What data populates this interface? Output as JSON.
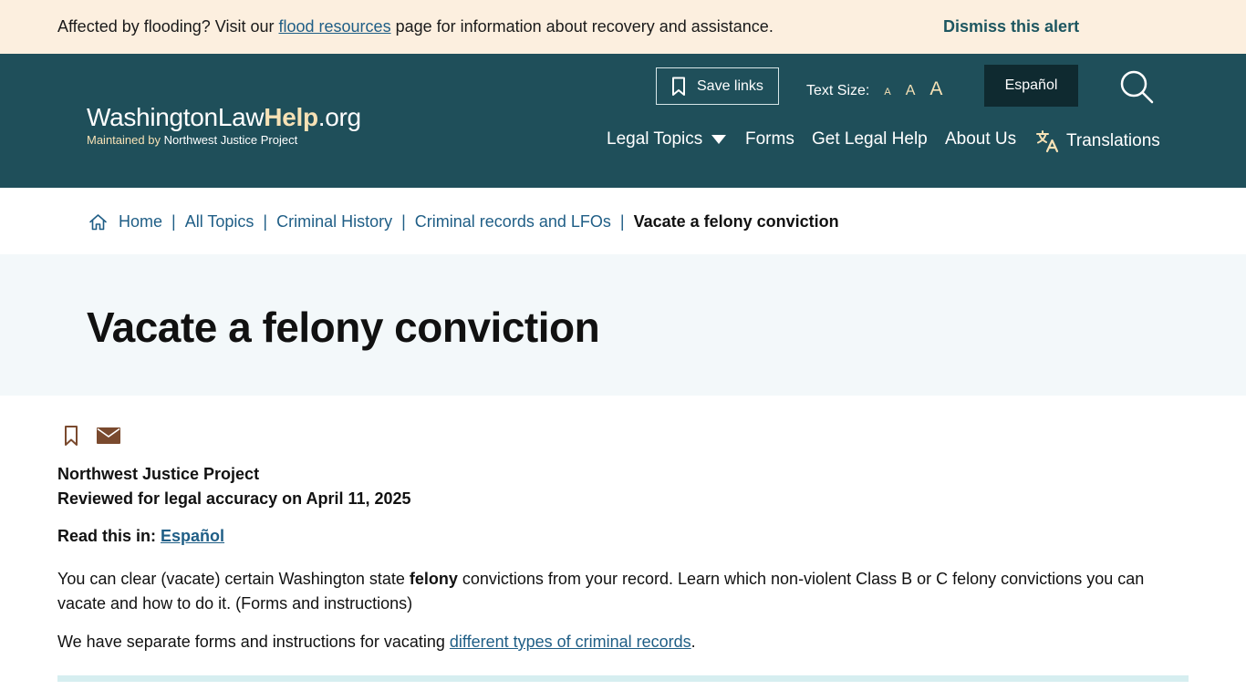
{
  "alert": {
    "prefix": "Affected by flooding? Visit our ",
    "link": "flood resources",
    "suffix": " page for information about recovery and assistance.",
    "dismiss": "Dismiss this alert"
  },
  "header": {
    "logo_main": "WashingtonLaw",
    "logo_help": "Help",
    "logo_tld": ".org",
    "logo_sub_prefix": "Maintained by ",
    "logo_sub_org": "Northwest Justice Project",
    "save_links": "Save links",
    "text_size_label": "Text Size:",
    "text_size_small": "A",
    "text_size_medium": "A",
    "text_size_large": "A",
    "language_button": "Español",
    "nav": [
      {
        "label": "Legal Topics"
      },
      {
        "label": "Forms"
      },
      {
        "label": "Get Legal Help"
      },
      {
        "label": "About Us"
      },
      {
        "label": "Translations"
      }
    ]
  },
  "breadcrumb": {
    "items": [
      "Home",
      "All Topics",
      "Criminal History",
      "Criminal records and LFOs"
    ],
    "separator": "|",
    "current": "Vacate a felony conviction"
  },
  "page": {
    "title": "Vacate a felony conviction",
    "author": "Northwest Justice Project",
    "reviewed": "Reviewed for legal accuracy on April 11, 2025",
    "read_in_label": "Read this in: ",
    "read_in_link": "Español",
    "intro_before": "You can clear (vacate) certain Washington state ",
    "intro_bold": "felony",
    "intro_after": " convictions from your record. Learn which non-violent Class B or C felony convictions you can vacate and how to do it. (Forms and instructions)",
    "para2_before": "We have separate forms and instructions for vacating ",
    "para2_link": "different types of criminal records",
    "para2_after": "."
  },
  "icons": {
    "bookmark": "bookmark-icon",
    "email": "email-icon",
    "search": "search-icon",
    "home": "home-icon",
    "translate": "translate-icon",
    "chevron": "chevron-down-icon"
  },
  "colors": {
    "alert_bg": "#fcefdf",
    "header_bg": "#1f4f5a",
    "accent": "#f6e1b5",
    "link": "#1f5e86",
    "title_band": "#f3f8fa",
    "icon_brown": "#7a4a2e",
    "divider": "#d6eef0"
  }
}
